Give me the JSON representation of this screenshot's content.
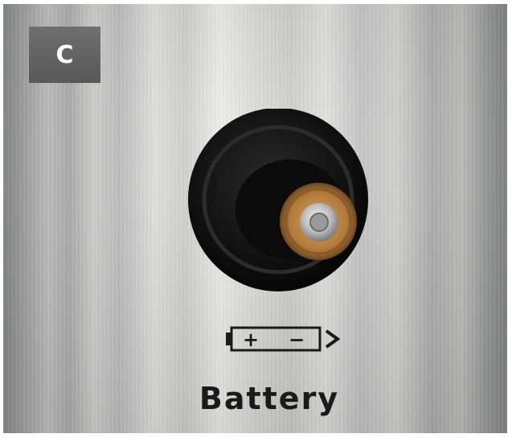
{
  "panel_label": "C",
  "polarity_symbol": {
    "plus": "+",
    "minus": "−"
  },
  "caption": "Battery",
  "colors": {
    "label_background": "#666666",
    "label_text": "#ffffff",
    "port_rubber": "#151515",
    "battery_wrap": "#b07a3a",
    "metal": "#d6d6d5",
    "print": "#1a1a1a"
  }
}
